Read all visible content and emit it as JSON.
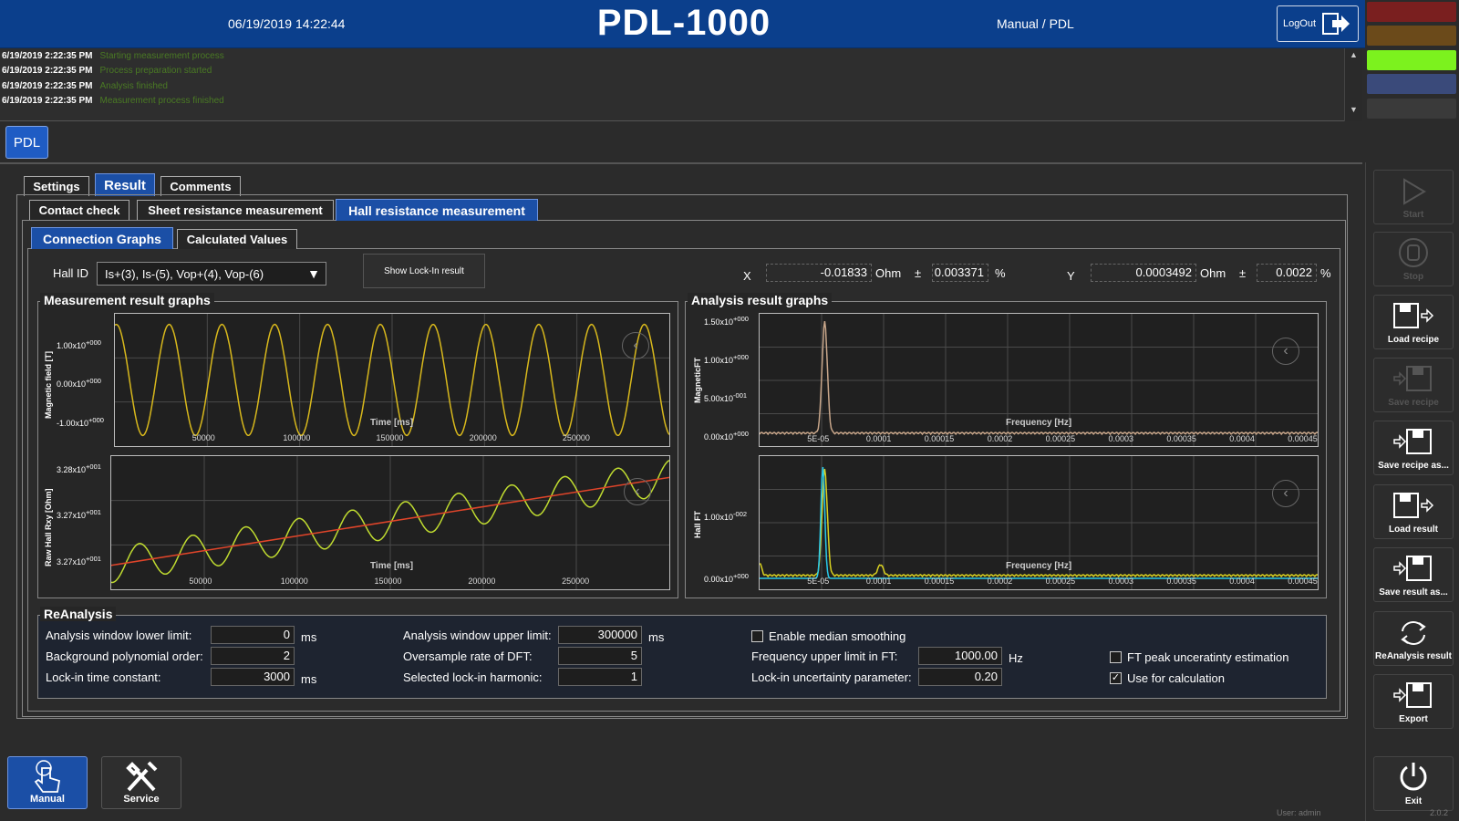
{
  "header": {
    "datetime": "06/19/2019 14:22:44",
    "title": "PDL-1000",
    "mode": "Manual / PDL",
    "logout_label": "LogOut"
  },
  "status_lamps": [
    "#7a1f1f",
    "#6b4a1a",
    "#7cf21e",
    "#3a4a7a",
    "#3a3a3a"
  ],
  "log": [
    {
      "time": "6/19/2019 2:22:35 PM",
      "message": "Starting measurement process"
    },
    {
      "time": "6/19/2019 2:22:35 PM",
      "message": "Process preparation started"
    },
    {
      "time": "6/19/2019 2:22:35 PM",
      "message": "Analysis finished"
    },
    {
      "time": "6/19/2019 2:22:35 PM",
      "message": "Measurement process finished"
    }
  ],
  "device_tab": "PDL",
  "tabs_main": [
    {
      "label": "Settings",
      "active": false
    },
    {
      "label": "Result",
      "active": true
    },
    {
      "label": "Comments",
      "active": false
    }
  ],
  "tabs_measure": [
    {
      "label": "Contact check",
      "active": false
    },
    {
      "label": "Sheet resistance measurement",
      "active": false
    },
    {
      "label": "Hall resistance measurement",
      "active": true
    }
  ],
  "tabs_view": [
    {
      "label": "Connection Graphs",
      "active": true
    },
    {
      "label": "Calculated Values",
      "active": false
    }
  ],
  "hall": {
    "label": "Hall ID",
    "selected": "Is+(3), Is-(5), Vop+(4), Vop-(6)",
    "lockin_button": "Show Lock-In result"
  },
  "results": {
    "x_label": "X",
    "x_value": "-0.01833",
    "x_unit": "Ohm",
    "pm": "±",
    "x_unc": "0.003371",
    "pct": "%",
    "y_label": "Y",
    "y_value": "0.0003492",
    "y_unit": "Ohm",
    "y_unc": "0.0022"
  },
  "graphs": {
    "measurement_title": "Measurement result graphs",
    "analysis_title": "Analysis result graphs",
    "mag": {
      "ylabel": "Magnetic field [T]",
      "xlabel": "Time [ms]",
      "yticks": [
        {
          "m": "1.00x10",
          "e": "+000"
        },
        {
          "m": "0.00x10",
          "e": "+000"
        },
        {
          "m": "-1.00x10",
          "e": "+000"
        }
      ],
      "xticks": [
        "50000",
        "100000",
        "150000",
        "200000",
        "250000"
      ],
      "color": "#d8b81c"
    },
    "hall_raw": {
      "ylabel": "Raw Hall Rxy [Ohm]",
      "xlabel": "Time [ms]",
      "yticks": [
        {
          "m": "3.28x10",
          "e": "+001"
        },
        {
          "m": "3.27x10",
          "e": "+001"
        },
        {
          "m": "3.27x10",
          "e": "+001"
        }
      ],
      "xticks": [
        "50000",
        "100000",
        "150000",
        "200000",
        "250000"
      ],
      "color": "#c0dc30",
      "fit_color": "#e0452a"
    },
    "mag_ft": {
      "ylabel": "MagneticFT",
      "xlabel": "Frequency [Hz]",
      "yticks": [
        {
          "m": "1.50x10",
          "e": "+000"
        },
        {
          "m": "1.00x10",
          "e": "+000"
        },
        {
          "m": "5.00x10",
          "e": "-001"
        },
        {
          "m": "0.00x10",
          "e": "+000"
        }
      ],
      "xticks": [
        "5E-05",
        "0.0001",
        "0.00015",
        "0.0002",
        "0.00025",
        "0.0003",
        "0.00035",
        "0.0004",
        "0.00045"
      ],
      "color": "#c8a68a"
    },
    "hall_ft": {
      "ylabel": "Hall FT",
      "xlabel": "Frequency [Hz]",
      "yticks": [
        {
          "m": "1.00x10",
          "e": "-002"
        },
        {
          "m": "0.00x10",
          "e": "+000"
        }
      ],
      "xticks": [
        "5E-05",
        "0.0001",
        "0.00015",
        "0.0002",
        "0.00025",
        "0.0003",
        "0.00035",
        "0.0004",
        "0.00045"
      ],
      "color": "#d8d020",
      "color2": "#28c8e8"
    }
  },
  "reanalysis": {
    "title": "ReAnalysis",
    "win_lower_label": "Analysis window lower limit:",
    "win_lower_value": "0",
    "win_lower_unit": "ms",
    "bg_poly_label": "Background polynomial order:",
    "bg_poly_value": "2",
    "lockin_tc_label": "Lock-in time constant:",
    "lockin_tc_value": "3000",
    "lockin_tc_unit": "ms",
    "win_upper_label": "Analysis window upper limit:",
    "win_upper_value": "300000",
    "win_upper_unit": "ms",
    "oversample_label": "Oversample rate of DFT:",
    "oversample_value": "5",
    "harmonic_label": "Selected lock-in harmonic:",
    "harmonic_value": "1",
    "median_label": "Enable median smoothing",
    "median_checked": false,
    "freq_upper_label": "Frequency upper limit in FT:",
    "freq_upper_value": "1000.00",
    "freq_upper_unit": "Hz",
    "unc_param_label": "Lock-in uncertainty parameter:",
    "unc_param_value": "0.20",
    "ft_peak_label": "FT peak unceratinty estimation",
    "ft_peak_checked": false,
    "use_calc_label": "Use for calculation",
    "use_calc_checked": true
  },
  "right_panel": {
    "start": "Start",
    "stop": "Stop",
    "load_recipe": "Load recipe",
    "save_recipe": "Save recipe",
    "save_recipe_as": "Save recipe as...",
    "load_result": "Load result",
    "save_result_as": "Save result as...",
    "reanalysis_result": "ReAnalysis result",
    "export": "Export",
    "exit": "Exit"
  },
  "bottom": {
    "manual": "Manual",
    "service": "Service",
    "user": "User: admin",
    "version": "2.0.2"
  }
}
